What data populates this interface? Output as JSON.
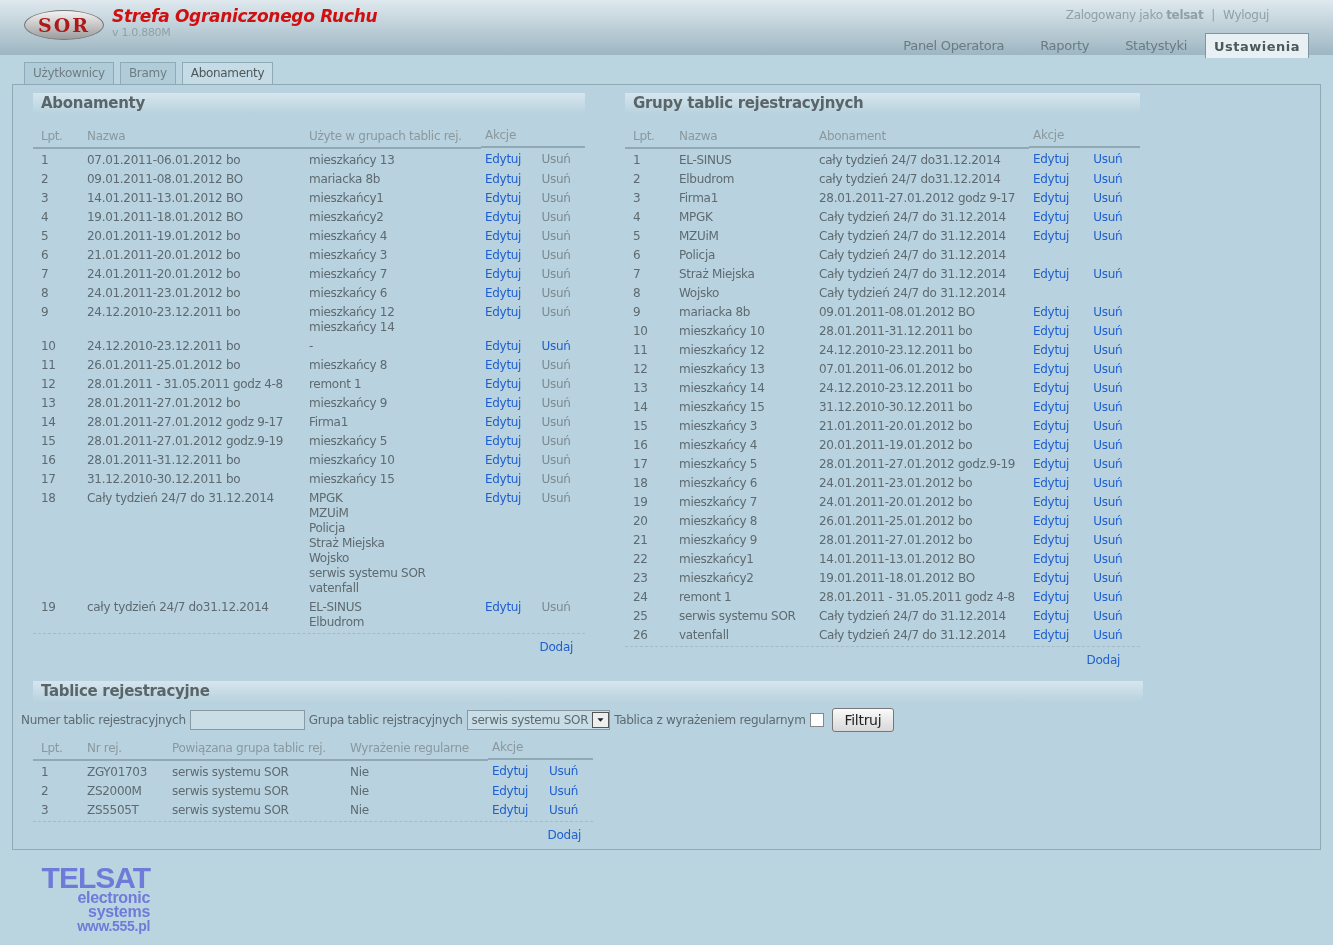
{
  "header": {
    "logo_text": "SOR",
    "title": "Strefa Ograniczonego Ruchu",
    "version": "v 1.0.880M",
    "user_line": "Zalogowany jako **telsat**",
    "separator": "|",
    "logout": "Wyloguj",
    "nav_tabs": [
      {
        "label": "Panel Operatora",
        "selected": false
      },
      {
        "label": "Raporty",
        "selected": false
      },
      {
        "label": "Statystyki",
        "selected": false
      },
      {
        "label": "Ustawienia",
        "selected": true
      }
    ]
  },
  "subtabs": [
    {
      "label": "Użytkownicy",
      "selected": false
    },
    {
      "label": "Bramy",
      "selected": false
    },
    {
      "label": "Abonamenty",
      "selected": true
    }
  ],
  "subscriptions": {
    "title": "Abonamenty",
    "columns": [
      "Lpt.",
      "Nazwa",
      "Użyte w grupach tablic rej.",
      "Akcje"
    ],
    "rows": [
      {
        "lp": "1",
        "name": "07.01.2011-06.01.2012 bo",
        "groups": [
          "mieszkańcy 13"
        ],
        "actions": {
          "edit": "Edytuj",
          "delete": "Usuń",
          "delete_enabled": false
        }
      },
      {
        "lp": "2",
        "name": "09.01.2011-08.01.2012 BO",
        "groups": [
          "mariacka 8b"
        ],
        "actions": {
          "edit": "Edytuj",
          "delete": "Usuń",
          "delete_enabled": false
        }
      },
      {
        "lp": "3",
        "name": "14.01.2011-13.01.2012 BO",
        "groups": [
          "mieszkańcy1"
        ],
        "actions": {
          "edit": "Edytuj",
          "delete": "Usuń",
          "delete_enabled": false
        }
      },
      {
        "lp": "4",
        "name": "19.01.2011-18.01.2012 BO",
        "groups": [
          "mieszkańcy2"
        ],
        "actions": {
          "edit": "Edytuj",
          "delete": "Usuń",
          "delete_enabled": false
        }
      },
      {
        "lp": "5",
        "name": "20.01.2011-19.01.2012 bo",
        "groups": [
          "mieszkańcy 4"
        ],
        "actions": {
          "edit": "Edytuj",
          "delete": "Usuń",
          "delete_enabled": false
        }
      },
      {
        "lp": "6",
        "name": "21.01.2011-20.01.2012 bo",
        "groups": [
          "mieszkańcy 3"
        ],
        "actions": {
          "edit": "Edytuj",
          "delete": "Usuń",
          "delete_enabled": false
        }
      },
      {
        "lp": "7",
        "name": "24.01.2011-20.01.2012 bo",
        "groups": [
          "mieszkańcy 7"
        ],
        "actions": {
          "edit": "Edytuj",
          "delete": "Usuń",
          "delete_enabled": false
        }
      },
      {
        "lp": "8",
        "name": "24.01.2011-23.01.2012 bo",
        "groups": [
          "mieszkańcy 6"
        ],
        "actions": {
          "edit": "Edytuj",
          "delete": "Usuń",
          "delete_enabled": false
        }
      },
      {
        "lp": "9",
        "name": "24.12.2010-23.12.2011 bo",
        "groups": [
          "mieszkańcy 12",
          "mieszkańcy 14"
        ],
        "actions": {
          "edit": "Edytuj",
          "delete": "Usuń",
          "delete_enabled": false
        }
      },
      {
        "lp": "10",
        "name": "24.12.2010-23.12.2011 bo",
        "groups": [
          "-"
        ],
        "actions": {
          "edit": "Edytuj",
          "delete": "Usuń",
          "delete_enabled": true
        }
      },
      {
        "lp": "11",
        "name": "26.01.2011-25.01.2012 bo",
        "groups": [
          "mieszkańcy 8"
        ],
        "actions": {
          "edit": "Edytuj",
          "delete": "Usuń",
          "delete_enabled": false
        }
      },
      {
        "lp": "12",
        "name": "28.01.2011 - 31.05.2011 godz 4-8",
        "groups": [
          "remont 1"
        ],
        "actions": {
          "edit": "Edytuj",
          "delete": "Usuń",
          "delete_enabled": false
        }
      },
      {
        "lp": "13",
        "name": "28.01.2011-27.01.2012 bo",
        "groups": [
          "mieszkańcy 9"
        ],
        "actions": {
          "edit": "Edytuj",
          "delete": "Usuń",
          "delete_enabled": false
        }
      },
      {
        "lp": "14",
        "name": "28.01.2011-27.01.2012 godz 9-17",
        "groups": [
          "Firma1"
        ],
        "actions": {
          "edit": "Edytuj",
          "delete": "Usuń",
          "delete_enabled": false
        }
      },
      {
        "lp": "15",
        "name": "28.01.2011-27.01.2012 godz.9-19",
        "groups": [
          "mieszkańcy 5"
        ],
        "actions": {
          "edit": "Edytuj",
          "delete": "Usuń",
          "delete_enabled": false
        }
      },
      {
        "lp": "16",
        "name": "28.01.2011-31.12.2011 bo",
        "groups": [
          "mieszkańcy 10"
        ],
        "actions": {
          "edit": "Edytuj",
          "delete": "Usuń",
          "delete_enabled": false
        }
      },
      {
        "lp": "17",
        "name": "31.12.2010-30.12.2011 bo",
        "groups": [
          "mieszkańcy 15"
        ],
        "actions": {
          "edit": "Edytuj",
          "delete": "Usuń",
          "delete_enabled": false
        }
      },
      {
        "lp": "18",
        "name": "Cały tydzień 24/7 do 31.12.2014",
        "groups": [
          "MPGK",
          "MZUiM",
          "Policja",
          "Straż Miejska",
          "Wojsko",
          "serwis systemu SOR",
          "vatenfall"
        ],
        "actions": {
          "edit": "Edytuj",
          "delete": "Usuń",
          "delete_enabled": false
        }
      },
      {
        "lp": "19",
        "name": "cały tydzień 24/7 do31.12.2014",
        "groups": [
          "EL-SINUS",
          "Elbudrom"
        ],
        "actions": {
          "edit": "Edytuj",
          "delete": "Usuń",
          "delete_enabled": false
        }
      }
    ],
    "add": "Dodaj"
  },
  "groups": {
    "title": "Grupy tablic rejestracyjnych",
    "columns": [
      "Lpt.",
      "Nazwa",
      "Abonament",
      "Akcje"
    ],
    "rows": [
      {
        "lp": "1",
        "name": "EL-SINUS",
        "subscription": "cały tydzień 24/7 do31.12.2014",
        "actions": {
          "edit": "Edytuj",
          "delete": "Usuń"
        }
      },
      {
        "lp": "2",
        "name": "Elbudrom",
        "subscription": "cały tydzień 24/7 do31.12.2014",
        "actions": {
          "edit": "Edytuj",
          "delete": "Usuń"
        }
      },
      {
        "lp": "3",
        "name": "Firma1",
        "subscription": "28.01.2011-27.01.2012 godz 9-17",
        "actions": {
          "edit": "Edytuj",
          "delete": "Usuń"
        }
      },
      {
        "lp": "4",
        "name": "MPGK",
        "subscription": "Cały tydzień 24/7 do 31.12.2014",
        "actions": {
          "edit": "Edytuj",
          "delete": "Usuń"
        }
      },
      {
        "lp": "5",
        "name": "MZUiM",
        "subscription": "Cały tydzień 24/7 do 31.12.2014",
        "actions": {
          "edit": "Edytuj",
          "delete": "Usuń"
        }
      },
      {
        "lp": "6",
        "name": "Policja",
        "subscription": "Cały tydzień 24/7 do 31.12.2014"
      },
      {
        "lp": "7",
        "name": "Straż Miejska",
        "subscription": "Cały tydzień 24/7 do 31.12.2014",
        "actions": {
          "edit": "Edytuj",
          "delete": "Usuń"
        }
      },
      {
        "lp": "8",
        "name": "Wojsko",
        "subscription": "Cały tydzień 24/7 do 31.12.2014"
      },
      {
        "lp": "9",
        "name": "mariacka 8b",
        "subscription": "09.01.2011-08.01.2012 BO",
        "actions": {
          "edit": "Edytuj",
          "delete": "Usuń"
        }
      },
      {
        "lp": "10",
        "name": "mieszkańcy 10",
        "subscription": "28.01.2011-31.12.2011 bo",
        "actions": {
          "edit": "Edytuj",
          "delete": "Usuń"
        }
      },
      {
        "lp": "11",
        "name": "mieszkańcy 12",
        "subscription": "24.12.2010-23.12.2011 bo",
        "actions": {
          "edit": "Edytuj",
          "delete": "Usuń"
        }
      },
      {
        "lp": "12",
        "name": "mieszkańcy 13",
        "subscription": "07.01.2011-06.01.2012 bo",
        "actions": {
          "edit": "Edytuj",
          "delete": "Usuń"
        }
      },
      {
        "lp": "13",
        "name": "mieszkańcy 14",
        "subscription": "24.12.2010-23.12.2011 bo",
        "actions": {
          "edit": "Edytuj",
          "delete": "Usuń"
        }
      },
      {
        "lp": "14",
        "name": "mieszkańcy 15",
        "subscription": "31.12.2010-30.12.2011 bo",
        "actions": {
          "edit": "Edytuj",
          "delete": "Usuń"
        }
      },
      {
        "lp": "15",
        "name": "mieszkańcy 3",
        "subscription": "21.01.2011-20.01.2012 bo",
        "actions": {
          "edit": "Edytuj",
          "delete": "Usuń"
        }
      },
      {
        "lp": "16",
        "name": "mieszkańcy 4",
        "subscription": "20.01.2011-19.01.2012 bo",
        "actions": {
          "edit": "Edytuj",
          "delete": "Usuń"
        }
      },
      {
        "lp": "17",
        "name": "mieszkańcy 5",
        "subscription": "28.01.2011-27.01.2012 godz.9-19",
        "actions": {
          "edit": "Edytuj",
          "delete": "Usuń"
        }
      },
      {
        "lp": "18",
        "name": "mieszkańcy 6",
        "subscription": "24.01.2011-23.01.2012 bo",
        "actions": {
          "edit": "Edytuj",
          "delete": "Usuń"
        }
      },
      {
        "lp": "19",
        "name": "mieszkańcy 7",
        "subscription": "24.01.2011-20.01.2012 bo",
        "actions": {
          "edit": "Edytuj",
          "delete": "Usuń"
        }
      },
      {
        "lp": "20",
        "name": "mieszkańcy 8",
        "subscription": "26.01.2011-25.01.2012 bo",
        "actions": {
          "edit": "Edytuj",
          "delete": "Usuń"
        }
      },
      {
        "lp": "21",
        "name": "mieszkańcy 9",
        "subscription": "28.01.2011-27.01.2012 bo",
        "actions": {
          "edit": "Edytuj",
          "delete": "Usuń"
        }
      },
      {
        "lp": "22",
        "name": "mieszkańcy1",
        "subscription": "14.01.2011-13.01.2012 BO",
        "actions": {
          "edit": "Edytuj",
          "delete": "Usuń"
        }
      },
      {
        "lp": "23",
        "name": "mieszkańcy2",
        "subscription": "19.01.2011-18.01.2012 BO",
        "actions": {
          "edit": "Edytuj",
          "delete": "Usuń"
        }
      },
      {
        "lp": "24",
        "name": "remont 1",
        "subscription": "28.01.2011 - 31.05.2011 godz 4-8",
        "actions": {
          "edit": "Edytuj",
          "delete": "Usuń"
        }
      },
      {
        "lp": "25",
        "name": "serwis systemu SOR",
        "subscription": "Cały tydzień 24/7 do 31.12.2014",
        "actions": {
          "edit": "Edytuj",
          "delete": "Usuń"
        }
      },
      {
        "lp": "26",
        "name": "vatenfall",
        "subscription": "Cały tydzień 24/7 do 31.12.2014",
        "actions": {
          "edit": "Edytuj",
          "delete": "Usuń"
        }
      }
    ],
    "add": "Dodaj"
  },
  "plates": {
    "title": "Tablice rejestracyjne",
    "filter": {
      "plate_label": "Numer tablic rejestracyjnych",
      "group_label": "Grupa tablic rejstracyjnych",
      "group_value": "serwis systemu SOR",
      "regex_label": "Tablica z wyrażeniem regularnym",
      "regex_checked": false,
      "button": "Filtruj"
    },
    "columns": [
      "Lpt.",
      "Nr rej.",
      "Powiązana grupa tablic rej.",
      "Wyrażenie regularne",
      "Akcje"
    ],
    "rows": [
      {
        "lp": "1",
        "plate": "ZGY01703",
        "group": "serwis systemu SOR",
        "regex": "Nie",
        "actions": {
          "edit": "Edytuj",
          "delete": "Usuń"
        }
      },
      {
        "lp": "2",
        "plate": "ZS2000M",
        "group": "serwis systemu SOR",
        "regex": "Nie",
        "actions": {
          "edit": "Edytuj",
          "delete": "Usuń"
        }
      },
      {
        "lp": "3",
        "plate": "ZS5505T",
        "group": "serwis systemu SOR",
        "regex": "Nie",
        "actions": {
          "edit": "Edytuj",
          "delete": "Usuń"
        }
      }
    ],
    "add": "Dodaj"
  },
  "footer_logo": {
    "brand": "TELSAT",
    "line1": "electronic",
    "line2": "systems",
    "url": "www.555.pl"
  }
}
